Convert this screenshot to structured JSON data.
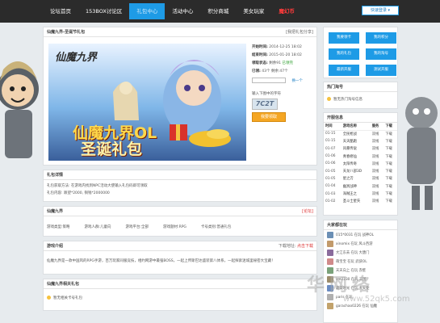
{
  "nav": {
    "items": [
      {
        "label": "论坛首页"
      },
      {
        "label": "153BOX讨论区"
      },
      {
        "label": "礼包中心"
      },
      {
        "label": "活动中心"
      },
      {
        "label": "积分商城"
      },
      {
        "label": "美女玩家"
      },
      {
        "label": "魔幻币"
      }
    ],
    "login": "快速登录 ▾"
  },
  "gift": {
    "title": "仙魔九界-圣诞节礼包",
    "share": "[我把礼包分享]",
    "banner_logo": "仙魔九界",
    "banner_line1": "仙魔九界OL",
    "banner_line2": "圣诞礼包",
    "start_label": "开始时间:",
    "start_value": "2014-12-25 18:02",
    "end_label": "结束时间:",
    "end_value": "2015-01-20 18:02",
    "remain_label": "领取状态:",
    "remain_value": "剩余91",
    "remain_tag": "已领完",
    "count_label": "已领:",
    "count_value": "43个  剩余:47个",
    "key_label": "卡号",
    "refresh": "换一个",
    "code_label": "输入下图中的字符",
    "captcha": "7C2T",
    "claim_button": "我要领取"
  },
  "details": {
    "title": "礼包详情",
    "line1": "礼包获取方法: 在游戏内找到NPC活动大使输入礼包码即可领取",
    "line2": "礼包内容: 跌望*2000, 铜钱*2000000"
  },
  "game": {
    "title": "仙魔九界",
    "more": "[论坛]",
    "fields": [
      "游戏类型:策略",
      "游戏人群:儿童向",
      "游戏平台:全部",
      "游戏题材:RPG",
      "卡号类别:普通礼包"
    ]
  },
  "intro": {
    "title": "游戏介绍",
    "download": "下载地址:",
    "download_link": "点击下载",
    "text": "仙魔九界是一款中国风的RPG手游，百万玩家同服竞技，相约网游中最强BOSS，一起上传斯巴达盛装第八体系，一起探索迷城里秘密大宝藏！"
  },
  "related": {
    "title": "仙魔九界相关礼包",
    "item": "暂无相关卡号礼包"
  },
  "sidebar": {
    "buttons": [
      {
        "label": "我要领卡"
      },
      {
        "label": "我的积分"
      },
      {
        "label": "我的礼包"
      },
      {
        "label": "我的淘号"
      },
      {
        "label": "最新开服"
      },
      {
        "label": "测试开服"
      }
    ],
    "hot_title": "热门淘号",
    "hot_item": "暂无热门淘号信息",
    "open_title": "开服信息",
    "table_headers": [
      "时间",
      "游戏名称",
      "服务",
      "下载"
    ],
    "table_rows": [
      [
        "01-15",
        "全民枪战",
        "双线",
        "下载"
      ],
      [
        "01-15",
        "天天酷跑",
        "双线",
        "下载"
      ],
      [
        "01-07",
        "风暴传说",
        "双线",
        "下载"
      ],
      [
        "01-06",
        "青春修仙",
        "双线",
        "下载"
      ],
      [
        "01-06",
        "太阳传奇",
        "双线",
        "下载"
      ],
      [
        "01-05",
        "天龙八部3D",
        "双线",
        "下载"
      ],
      [
        "01-05",
        "星之刃",
        "双线",
        "下载"
      ],
      [
        "01-04",
        "幽冥战神",
        "双线",
        "下载"
      ],
      [
        "01-03",
        "海贼王之",
        "双线",
        "下载"
      ],
      [
        "01-02",
        "圣斗士星矢",
        "双线",
        "下载"
      ]
    ],
    "users_title": "大家都在玩",
    "users": [
      {
        "text": "015*0031 在玩 战神OL",
        "color": "#6b8fb5"
      },
      {
        "text": "xinomix 在玩 风斗西游",
        "color": "#c29a6b"
      },
      {
        "text": "大江东去 在玩 大唐门",
        "color": "#8a6b9c"
      },
      {
        "text": "萌宝宝 在玩 武侠OL",
        "color": "#d08a8a"
      },
      {
        "text": "天天向上 在玩 赤壁",
        "color": "#7aa27a"
      },
      {
        "text": "lee2230 在玩 三国",
        "color": "#9c8c6b"
      },
      {
        "text": "最美时光 在玩 大天使",
        "color": "#6b8cc2"
      },
      {
        "text": "paris 在玩 ",
        "color": "#b0b0b0"
      },
      {
        "text": "garachao0226 在玩 仙魔",
        "color": "#c2a26b"
      }
    ]
  },
  "watermark": {
    "main": "华网络",
    "sub": "www.52qk5.com"
  }
}
